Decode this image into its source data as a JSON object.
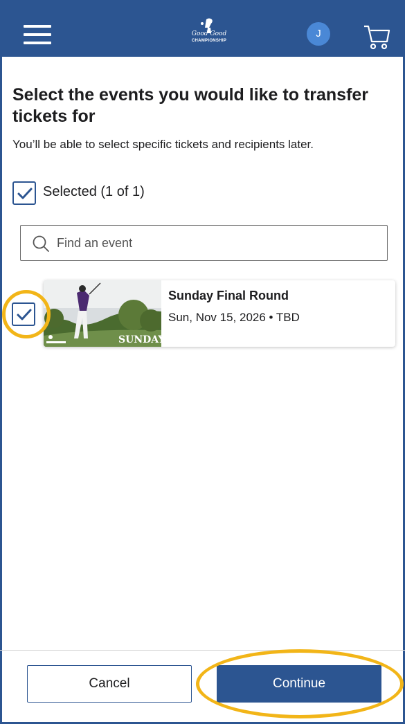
{
  "header": {
    "menu_icon": "hamburger-menu-icon",
    "logo": {
      "line1": "Good Good",
      "line2": "CHAMPIONSHIP"
    },
    "avatar_initial": "J",
    "cart_icon": "shopping-cart-icon",
    "brand_color": "#2c5591",
    "avatar_color": "#4a88d6"
  },
  "main": {
    "title": "Select the events you would like to transfer tickets for",
    "subtitle": "You’ll be able to select specific tickets and recipients later.",
    "select_all": {
      "label": "Selected (1 of 1)",
      "checked": true
    },
    "search": {
      "placeholder": "Find an event",
      "value": "",
      "icon": "search-icon"
    },
    "events": [
      {
        "name": "Sunday Final Round",
        "date": "Sun, Nov 15, 2026 • TBD",
        "image_caption": "SUNDAY",
        "checked": true
      }
    ]
  },
  "footer": {
    "cancel_label": "Cancel",
    "continue_label": "Continue"
  },
  "highlight_color": "#f2b518"
}
